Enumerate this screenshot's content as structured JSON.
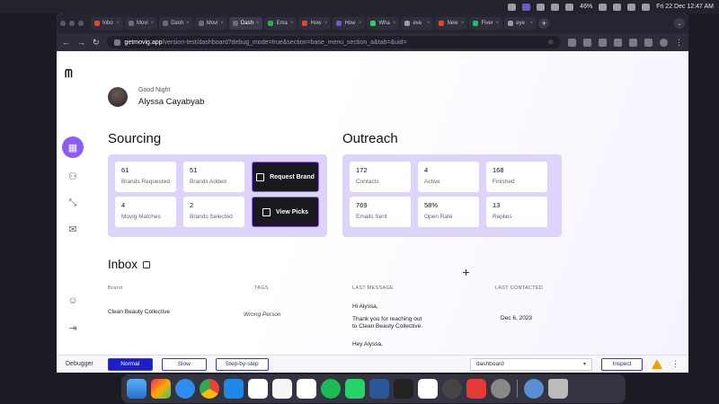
{
  "menubar": {
    "datetime": "Fri 22 Dec  12:47 AM",
    "battery": "46%"
  },
  "browser": {
    "tabs": [
      {
        "label": "Inbo",
        "color": "#ea4335"
      },
      {
        "label": "Movi",
        "color": "#6b6b7b"
      },
      {
        "label": "Dash",
        "color": "#6b6b7b"
      },
      {
        "label": "Movi",
        "color": "#6b6b7b"
      },
      {
        "label": "Dash",
        "color": "#6b6b7b",
        "active": true
      },
      {
        "label": "Ema",
        "color": "#34a853"
      },
      {
        "label": "How",
        "color": "#ea4335"
      },
      {
        "label": "How",
        "color": "#6a5acd"
      },
      {
        "label": "Wha",
        "color": "#25d366"
      },
      {
        "label": "eve",
        "color": "#9a9aa8"
      },
      {
        "label": "New",
        "color": "#ea4335"
      },
      {
        "label": "Fiver",
        "color": "#1dbf73"
      },
      {
        "label": "eye",
        "color": "#9a9aa8"
      }
    ],
    "url_host": "getmovig.app",
    "url_path": "/version-test/dashboard?debug_mode=true&section=base_menu_section_a&tab=&uid="
  },
  "app": {
    "logo": "ᗰ",
    "greeting": "Good Night",
    "user_name": "Alyssa Cayabyab",
    "sourcing": {
      "title": "Sourcing",
      "stats": [
        {
          "value": "61",
          "label": "Brands Requested"
        },
        {
          "value": "51",
          "label": "Brands Added"
        },
        {
          "value": "4",
          "label": "Movig Matches"
        },
        {
          "value": "2",
          "label": "Brands Selected"
        }
      ],
      "actions": [
        "Request Brand",
        "View Picks"
      ]
    },
    "outreach": {
      "title": "Outreach",
      "stats": [
        {
          "value": "172",
          "label": "Contacts"
        },
        {
          "value": "4",
          "label": "Active"
        },
        {
          "value": "168",
          "label": "Finished"
        },
        {
          "value": "769",
          "label": "Emails Sent"
        },
        {
          "value": "58%",
          "label": "Open Rate"
        },
        {
          "value": "13",
          "label": "Replies"
        }
      ]
    },
    "inbox": {
      "title": "Inbox",
      "columns": [
        "Brand",
        "TAGS",
        "LAST MESSAGE",
        "LAST CONTACTED"
      ],
      "rows": [
        {
          "brand": "Clean Beauty Collective",
          "tag": "Wrong Person",
          "message_line1": "Hi Alyssa,",
          "message_line2": "Thank you for reaching out",
          "message_line3": "to Clean Beauty Collective.",
          "date": "Dec 6, 2023"
        },
        {
          "message_line1": "Hey Alyssa,"
        }
      ]
    }
  },
  "debugger": {
    "label": "Debugger",
    "modes": [
      "Normal",
      "Slow",
      "Step-by-step"
    ],
    "page_select": "dashboard",
    "inspect": "Inspect"
  }
}
